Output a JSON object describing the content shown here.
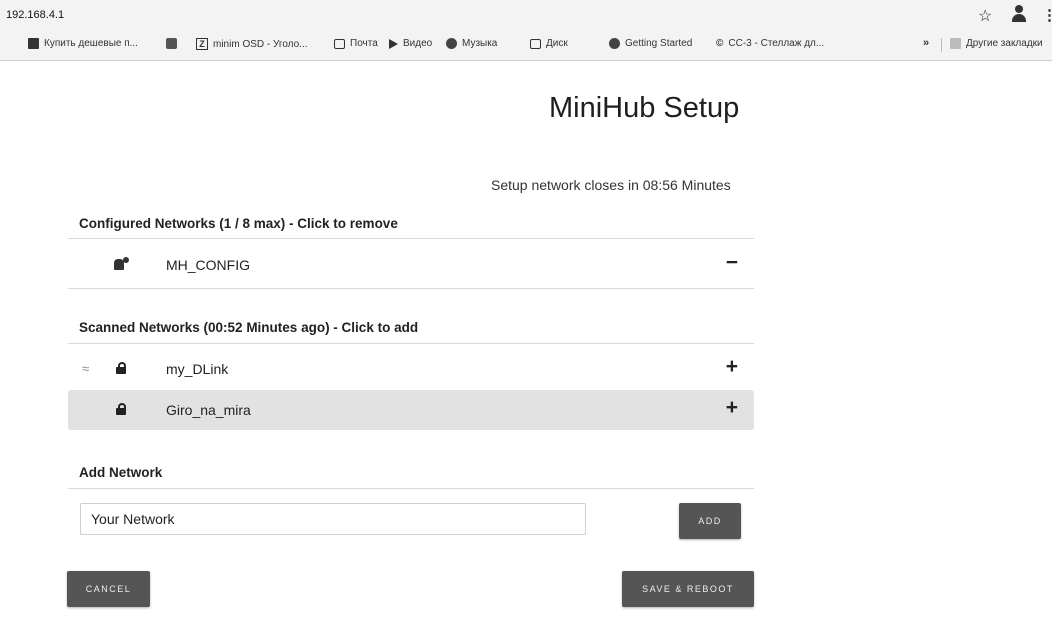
{
  "browser": {
    "url": "192.168.4.1",
    "icons": [
      "star-icon",
      "profile-icon",
      "menu-icon"
    ],
    "bookmarks": [
      {
        "label": "Купить дешевые п...",
        "icon": "folder-icon"
      },
      {
        "label": "",
        "icon": "app-icon"
      },
      {
        "label": "minim OSD - Уголо...",
        "icon": "z-icon"
      },
      {
        "label": "Почта",
        "icon": "mail-icon"
      },
      {
        "label": "Видео",
        "icon": "play-icon"
      },
      {
        "label": "Музыка",
        "icon": "music-icon"
      },
      {
        "label": "Диск",
        "icon": "disk-icon"
      },
      {
        "label": "Getting Started",
        "icon": "globe-icon"
      },
      {
        "label": "CC-3 - Стеллаж дл...",
        "icon": "cc-icon"
      }
    ],
    "overflow": "»",
    "other_bookmarks": "Другие закладки"
  },
  "page": {
    "title": "MiniHub Setup",
    "timer_text": "Setup network closes in 08:56 Minutes"
  },
  "configured": {
    "heading": "Configured Networks (1 / 8 max) - Click to remove",
    "networks": [
      {
        "name": "MH_CONFIG",
        "action": "−"
      }
    ]
  },
  "scanned": {
    "heading": "Scanned Networks (00:52 Minutes ago) - Click to add",
    "networks": [
      {
        "name": "my_DLink",
        "action": "+"
      },
      {
        "name": "Giro_na_mira",
        "action": "+"
      }
    ]
  },
  "add_network": {
    "heading": "Add Network",
    "input_value": "Your Network",
    "add_label": "ADD"
  },
  "footer": {
    "cancel_label": "CANCEL",
    "save_label": "SAVE & REBOOT"
  },
  "colors": {
    "button_bg": "#555555",
    "row_highlight": "#e2e2e2",
    "divider": "#d9d9d9"
  }
}
